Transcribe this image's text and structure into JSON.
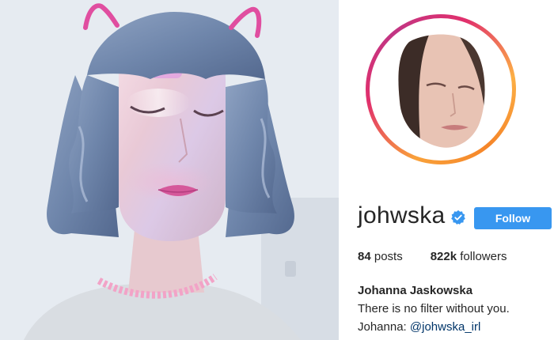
{
  "profile": {
    "username": "johwska",
    "verified_icon": "verified-badge-icon",
    "follow_label": "Follow",
    "posts_count": "84",
    "posts_label": "posts",
    "followers_count": "822k",
    "followers_label": "followers",
    "full_name": "Johanna Jaskowska",
    "bio": "There is no filter without you.",
    "bio_link_prefix": "Johanna:",
    "bio_mention": "@johwska_irl"
  },
  "colors": {
    "follow_button": "#3897f0",
    "verified_badge": "#3897f0",
    "mention_link": "#003569",
    "ring_gradient": [
      "#f9a13a",
      "#e1306c",
      "#c13584",
      "#fcaf45"
    ]
  },
  "photo": {
    "filter_icon": "cat-ears-icon"
  }
}
